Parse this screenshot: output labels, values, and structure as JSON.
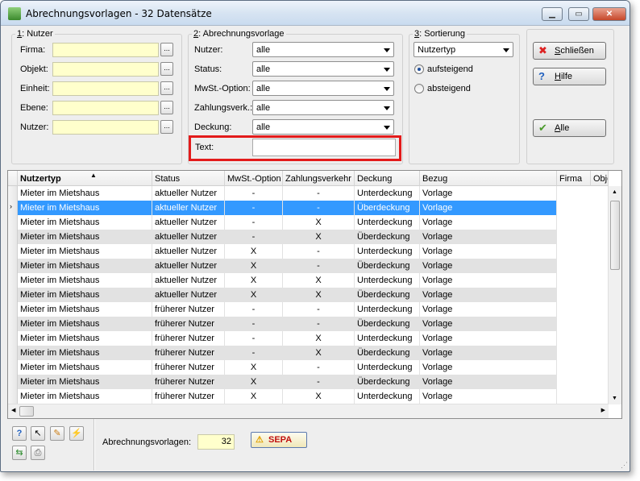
{
  "window": {
    "title": "Abrechnungsvorlagen - 32 Datensätze",
    "controls": [
      "minimize",
      "maximize",
      "close"
    ]
  },
  "nutzer_group": {
    "legend_key": "1",
    "legend": ": Nutzer",
    "fields": [
      {
        "label": "Firma:",
        "value": ""
      },
      {
        "label": "Objekt:",
        "value": ""
      },
      {
        "label": "Einheit:",
        "value": ""
      },
      {
        "label": "Ebene:",
        "value": ""
      },
      {
        "label": "Nutzer:",
        "value": ""
      }
    ],
    "ellipsis": "..."
  },
  "vorlage_group": {
    "legend_key": "2",
    "legend": ": Abrechnungsvorlage",
    "combos": [
      {
        "label": "Nutzer:",
        "value": "alle"
      },
      {
        "label": "Status:",
        "value": "alle"
      },
      {
        "label": "MwSt.-Option:",
        "value": "alle"
      },
      {
        "label": "Zahlungsverk.:",
        "value": "alle"
      },
      {
        "label": "Deckung:",
        "value": "alle"
      }
    ],
    "text_label": "Text:",
    "text_value": ""
  },
  "sortierung_group": {
    "legend_key": "3",
    "legend": ": Sortierung",
    "field_value": "Nutzertyp",
    "options": [
      {
        "label": "aufsteigend",
        "selected": true
      },
      {
        "label": "absteigend",
        "selected": false
      }
    ]
  },
  "buttons": {
    "schliessen_key": "S",
    "schliessen": "chließen",
    "hilfe_key": "H",
    "hilfe": "ilfe",
    "alle_key": "A",
    "alle": "lle"
  },
  "grid": {
    "columns": [
      "Nutzertyp",
      "Status",
      "MwSt.-Option",
      "Zahlungsverkehr",
      "Deckung",
      "Bezug",
      "Firma",
      "Obje"
    ],
    "sorted_column": "Nutzertyp",
    "selected_row_index": 1,
    "rows": [
      [
        "Mieter im Mietshaus",
        "aktueller Nutzer",
        "-",
        "-",
        "Unterdeckung",
        "Vorlage"
      ],
      [
        "Mieter im Mietshaus",
        "aktueller Nutzer",
        "-",
        "-",
        "Überdeckung",
        "Vorlage"
      ],
      [
        "Mieter im Mietshaus",
        "aktueller Nutzer",
        "-",
        "X",
        "Unterdeckung",
        "Vorlage"
      ],
      [
        "Mieter im Mietshaus",
        "aktueller Nutzer",
        "-",
        "X",
        "Überdeckung",
        "Vorlage"
      ],
      [
        "Mieter im Mietshaus",
        "aktueller Nutzer",
        "X",
        "-",
        "Unterdeckung",
        "Vorlage"
      ],
      [
        "Mieter im Mietshaus",
        "aktueller Nutzer",
        "X",
        "-",
        "Überdeckung",
        "Vorlage"
      ],
      [
        "Mieter im Mietshaus",
        "aktueller Nutzer",
        "X",
        "X",
        "Unterdeckung",
        "Vorlage"
      ],
      [
        "Mieter im Mietshaus",
        "aktueller Nutzer",
        "X",
        "X",
        "Überdeckung",
        "Vorlage"
      ],
      [
        "Mieter im Mietshaus",
        "früherer Nutzer",
        "-",
        "-",
        "Unterdeckung",
        "Vorlage"
      ],
      [
        "Mieter im Mietshaus",
        "früherer Nutzer",
        "-",
        "-",
        "Überdeckung",
        "Vorlage"
      ],
      [
        "Mieter im Mietshaus",
        "früherer Nutzer",
        "-",
        "X",
        "Unterdeckung",
        "Vorlage"
      ],
      [
        "Mieter im Mietshaus",
        "früherer Nutzer",
        "-",
        "X",
        "Überdeckung",
        "Vorlage"
      ],
      [
        "Mieter im Mietshaus",
        "früherer Nutzer",
        "X",
        "-",
        "Unterdeckung",
        "Vorlage"
      ],
      [
        "Mieter im Mietshaus",
        "früherer Nutzer",
        "X",
        "-",
        "Überdeckung",
        "Vorlage"
      ],
      [
        "Mieter im Mietshaus",
        "früherer Nutzer",
        "X",
        "X",
        "Unterdeckung",
        "Vorlage"
      ]
    ]
  },
  "footer": {
    "count_label": "Abrechnungsvorlagen:",
    "count_value": "32",
    "sepa_label": "SEPA",
    "toolbar_icons": [
      "help-icon",
      "pointer-icon",
      "edit-icon",
      "lightning-icon",
      "refresh-icon",
      "print-icon"
    ]
  },
  "colors": {
    "field_bg": "#ffffcc",
    "selection": "#3399ff",
    "highlight_border": "#e31b1b"
  }
}
